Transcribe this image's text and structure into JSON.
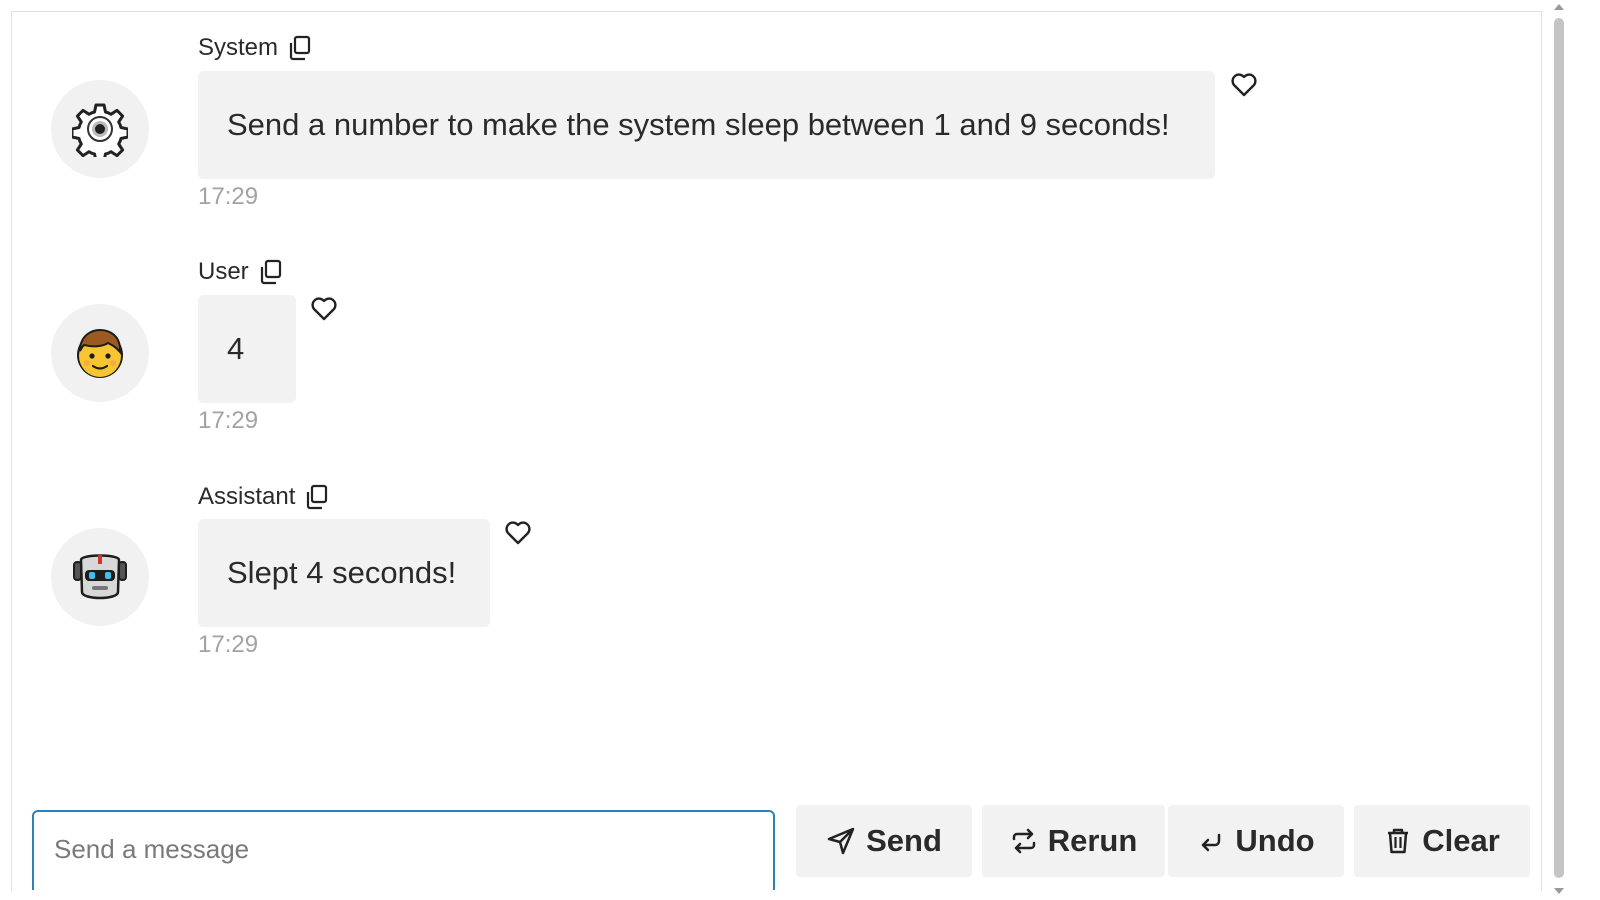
{
  "messages": [
    {
      "sender": "System",
      "text": "Send a number to make the system sleep between 1 and 9 seconds!",
      "time": "17:29",
      "avatar": "gear-icon"
    },
    {
      "sender": "User",
      "text": "4",
      "time": "17:29",
      "avatar": "boy-face-icon"
    },
    {
      "sender": "Assistant",
      "text": "Slept 4 seconds!",
      "time": "17:29",
      "avatar": "robot-face-icon"
    }
  ],
  "composer": {
    "placeholder": "Send a message"
  },
  "buttons": {
    "send": "Send",
    "rerun": "Rerun",
    "undo": "Undo",
    "clear": "Clear"
  },
  "colors": {
    "bubble": "#f2f2f2",
    "input_border": "#2f7fb8",
    "timestamp": "#a2a2a2"
  }
}
